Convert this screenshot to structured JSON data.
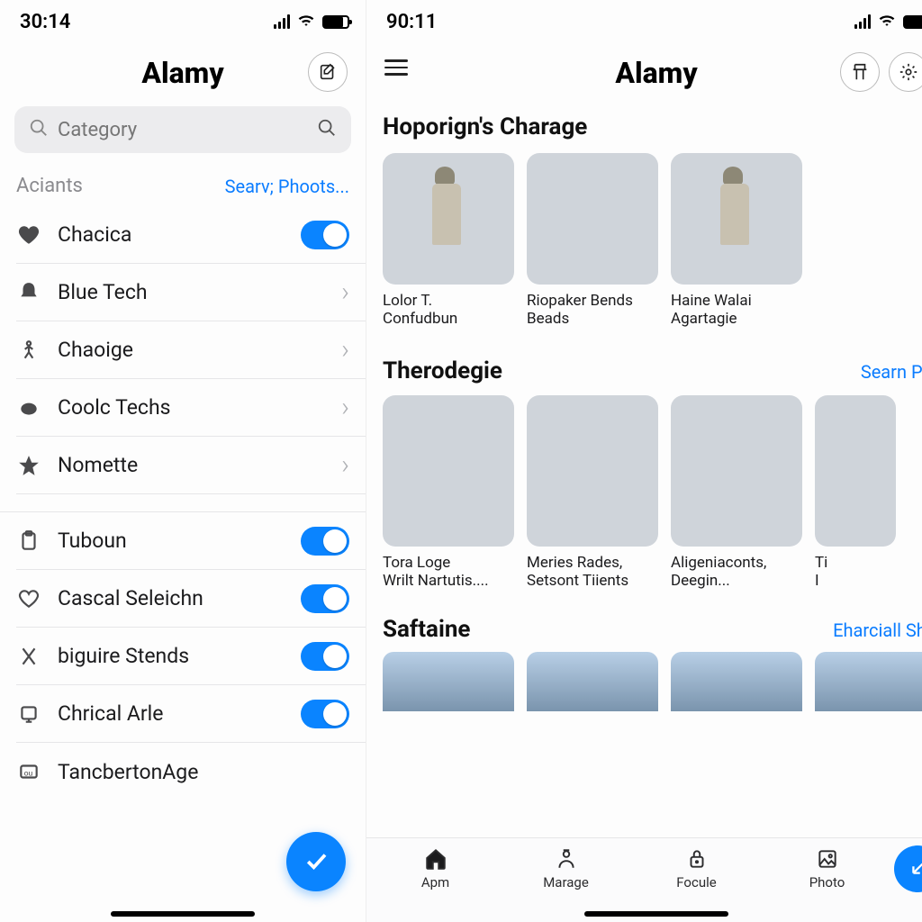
{
  "left": {
    "status_time": "30:14",
    "app_title": "Alamy",
    "search_placeholder": "Category",
    "section_header": "Aciants",
    "section_link": "Searv; Phoots...",
    "group1": [
      {
        "icon": "heart-icon",
        "label": "Chacica",
        "ctrl": "toggle",
        "on": true
      },
      {
        "icon": "bell-icon",
        "label": "Blue Tech",
        "ctrl": "chevron"
      },
      {
        "icon": "person-stick-icon",
        "label": "Chaoige",
        "ctrl": "chevron"
      },
      {
        "icon": "piggy-icon",
        "label": "Coolc Techs",
        "ctrl": "chevron"
      },
      {
        "icon": "star-icon",
        "label": "Nomette",
        "ctrl": "chevron"
      }
    ],
    "group2": [
      {
        "icon": "clipboard-icon",
        "label": "Tuboun",
        "ctrl": "toggle",
        "on": true
      },
      {
        "icon": "heart-outline-icon",
        "label": "Cascal Seleichn",
        "ctrl": "toggle",
        "on": true
      },
      {
        "icon": "x-cross-icon",
        "label": "biguire Stends",
        "ctrl": "toggle",
        "on": true
      },
      {
        "icon": "device-icon",
        "label": "Chrical Arle",
        "ctrl": "toggle",
        "on": true
      },
      {
        "icon": "card-ou-icon",
        "label": "TancbertonAge",
        "ctrl": "fab-check"
      }
    ]
  },
  "right": {
    "status_time": "90:11",
    "app_title": "Alamy",
    "section1_title": "Hoporign's Charage",
    "section1_cards": [
      {
        "scene": "scn-tower",
        "line1": "Lolor T.",
        "line2": "Confudbun"
      },
      {
        "scene": "scn-hills",
        "line1": "Riopaker Bends",
        "line2": "Beads"
      },
      {
        "scene": "scn-tower",
        "line1": "Haine Walai",
        "line2": "Agartagie"
      }
    ],
    "section2_title": "Therodegie",
    "section2_link": "Searn Pho",
    "section2_cards": [
      {
        "scene": "scn-arcade",
        "line1": "Tora Loge",
        "line2": "Wrilt Nartutis...."
      },
      {
        "scene": "scn-water",
        "line1": "Meries Rades,",
        "line2": "Setsont Tiients"
      },
      {
        "scene": "scn-window",
        "line1": "Aligeniaconts,",
        "line2": "Deegin..."
      },
      {
        "scene": "scn-water",
        "line1": "Ti",
        "line2": "I"
      }
    ],
    "section3_title": "Saftaine",
    "section3_link": "Eharciall Shor",
    "nav": [
      {
        "icon": "home-icon",
        "label": "Apm"
      },
      {
        "icon": "profile-icon",
        "label": "Marage"
      },
      {
        "icon": "lock-icon",
        "label": "Focule"
      },
      {
        "icon": "image-icon",
        "label": "Photo"
      }
    ]
  }
}
